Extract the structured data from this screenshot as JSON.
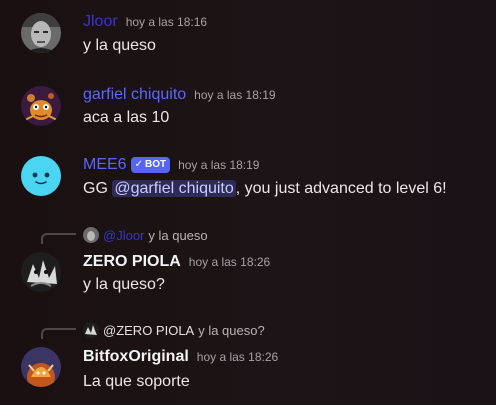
{
  "colors": {
    "jloor": "#3b35c8",
    "garfiel": "#5a67ff",
    "mee6": "#5a67ff",
    "zero": "#f2f3f5",
    "bitfox": "#f2f3f5",
    "bot_tag": "#5865f2"
  },
  "messages": [
    {
      "author": "Jloor",
      "timestamp": "hoy a las 18:16",
      "content": "y la queso",
      "avatar_icon": "jloor-avatar-icon"
    },
    {
      "author": "garfiel chiquito",
      "timestamp": "hoy a las 18:19",
      "content": "aca a las 10",
      "avatar_icon": "garfiel-avatar-icon"
    },
    {
      "author": "MEE6",
      "bot_tag": "BOT",
      "timestamp": "hoy a las 18:19",
      "content_prefix": "GG ",
      "mention": "@garfiel chiquito",
      "content_suffix": ", you just advanced to level 6!",
      "avatar_icon": "mee6-avatar-icon"
    },
    {
      "reply_author": "@Jloor",
      "reply_text": "y la queso",
      "author": "ZERO PIOLA",
      "timestamp": "hoy a las 18:26",
      "content": "y la queso?",
      "avatar_icon": "zero-avatar-icon"
    },
    {
      "reply_author": "@ZERO PIOLA",
      "reply_text": "y la queso?",
      "author": "BitfoxOriginal",
      "timestamp": "hoy a las 18:26",
      "content": "La que soporte",
      "avatar_icon": "bitfox-avatar-icon"
    }
  ]
}
